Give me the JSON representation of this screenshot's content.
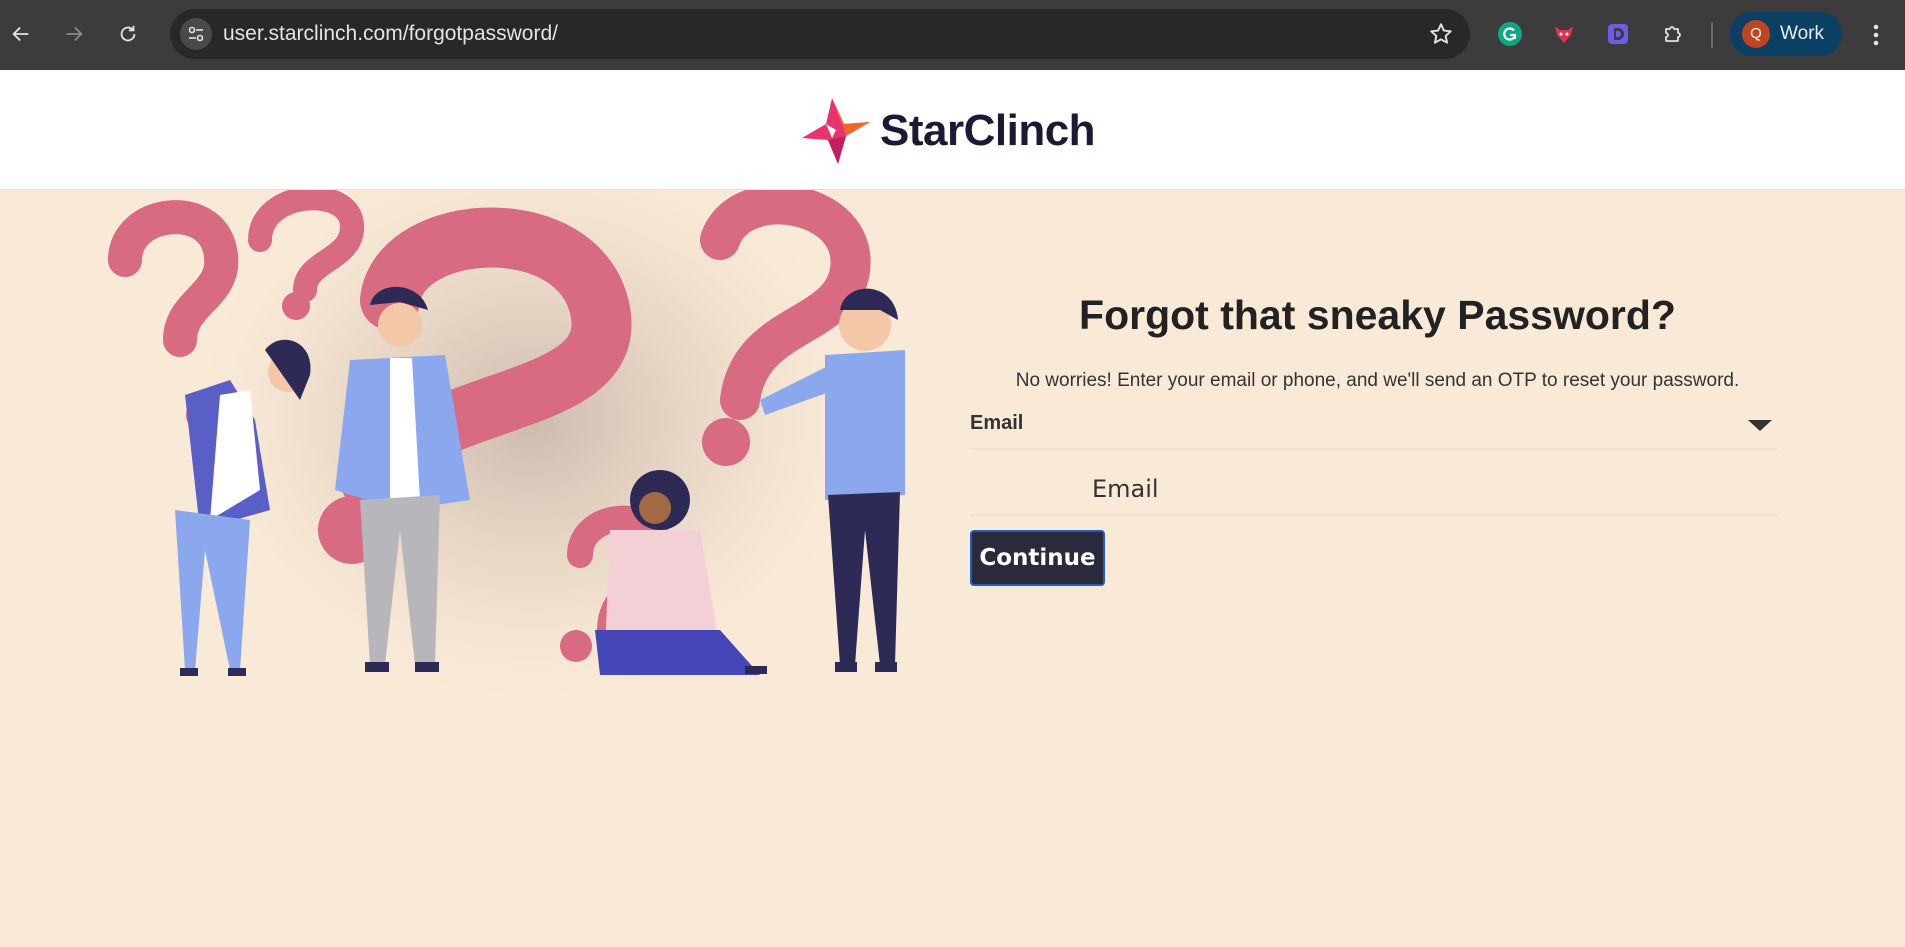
{
  "browser": {
    "url": "user.starclinch.com/forgotpassword/",
    "profile_initial": "Q",
    "profile_label": "Work",
    "extensions": [
      "grammarly-icon",
      "fox-extension-icon",
      "d-extension-icon",
      "puzzle-extensions-icon"
    ]
  },
  "site": {
    "brand_name": "StarClinch",
    "brand_colors": {
      "pink": "#e8336e",
      "orange": "#f2662e",
      "navy": "#1b1934"
    }
  },
  "form": {
    "heading": "Forgot that sneaky Password?",
    "subtext": "No worries! Enter your email or phone, and we'll send an OTP to reset your password.",
    "method_selected": "Email",
    "input_placeholder": "Email",
    "submit_label": "Continue"
  },
  "colors": {
    "page_bg": "#f9ead7",
    "button_bg": "#2a2a3c",
    "button_border": "#1f5fbf",
    "chrome_bg": "#3c3c3c"
  }
}
